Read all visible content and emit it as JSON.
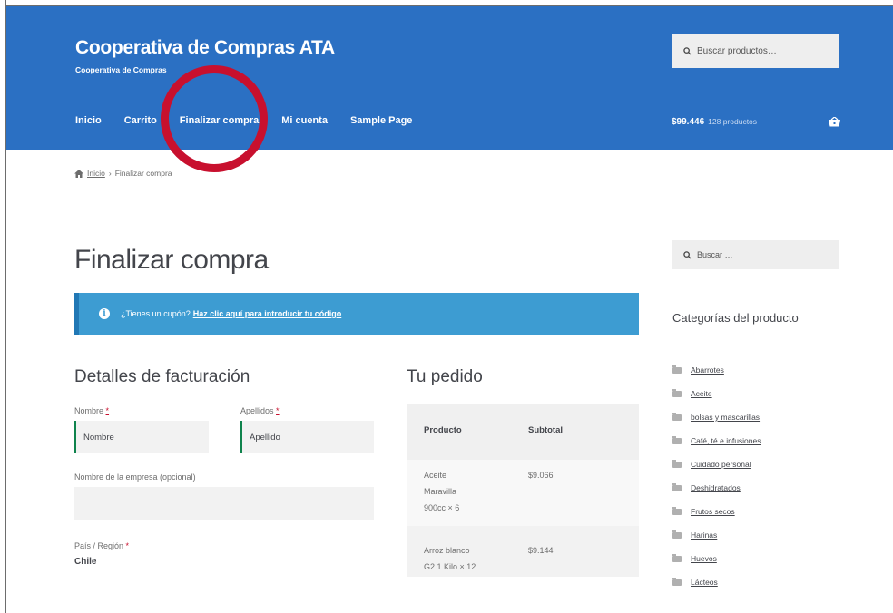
{
  "header": {
    "site_title": "Cooperativa de Compras ATA",
    "site_description": "Cooperativa de Compras",
    "search_placeholder": "Buscar productos…",
    "nav": [
      "Inicio",
      "Carrito",
      "Finalizar compra",
      "Mi cuenta",
      "Sample Page"
    ],
    "cart_total": "$99.446",
    "cart_count": "128 productos"
  },
  "breadcrumb": {
    "home": "Inicio",
    "separator": "›",
    "current": "Finalizar compra"
  },
  "page_title": "Finalizar compra",
  "coupon": {
    "text": "¿Tienes un cupón?",
    "link": "Haz clic aquí para introducir tu código"
  },
  "billing": {
    "title": "Detalles de facturación",
    "first_name_label": "Nombre",
    "first_name_value": "Nombre",
    "last_name_label": "Apellidos",
    "last_name_value": "Apellido",
    "company_label": "Nombre de la empresa (opcional)",
    "country_label": "País / Región",
    "country_value": "Chile",
    "required_mark": "*"
  },
  "order": {
    "title": "Tu pedido",
    "col_product": "Producto",
    "col_subtotal": "Subtotal",
    "rows": [
      {
        "line1": "Aceite",
        "line2": "Maravilla",
        "line3": "900cc × 6",
        "price": "$9.066"
      },
      {
        "line1": "Arroz blanco",
        "line2": "G2 1 Kilo × 12",
        "price": "$9.144"
      }
    ]
  },
  "sidebar": {
    "search_placeholder": "Buscar …",
    "categories_title": "Categorías del producto",
    "categories": [
      "Abarrotes",
      "Aceite",
      "bolsas y mascarillas",
      "Café, té e infusiones",
      "Cuidado personal",
      "Deshidratados",
      "Frutos secos",
      "Harinas",
      "Huevos",
      "Lácteos"
    ]
  },
  "colors": {
    "header_bg": "#2b70c3",
    "coupon_bg": "#3d9cd2",
    "annotation": "#c8102e"
  }
}
